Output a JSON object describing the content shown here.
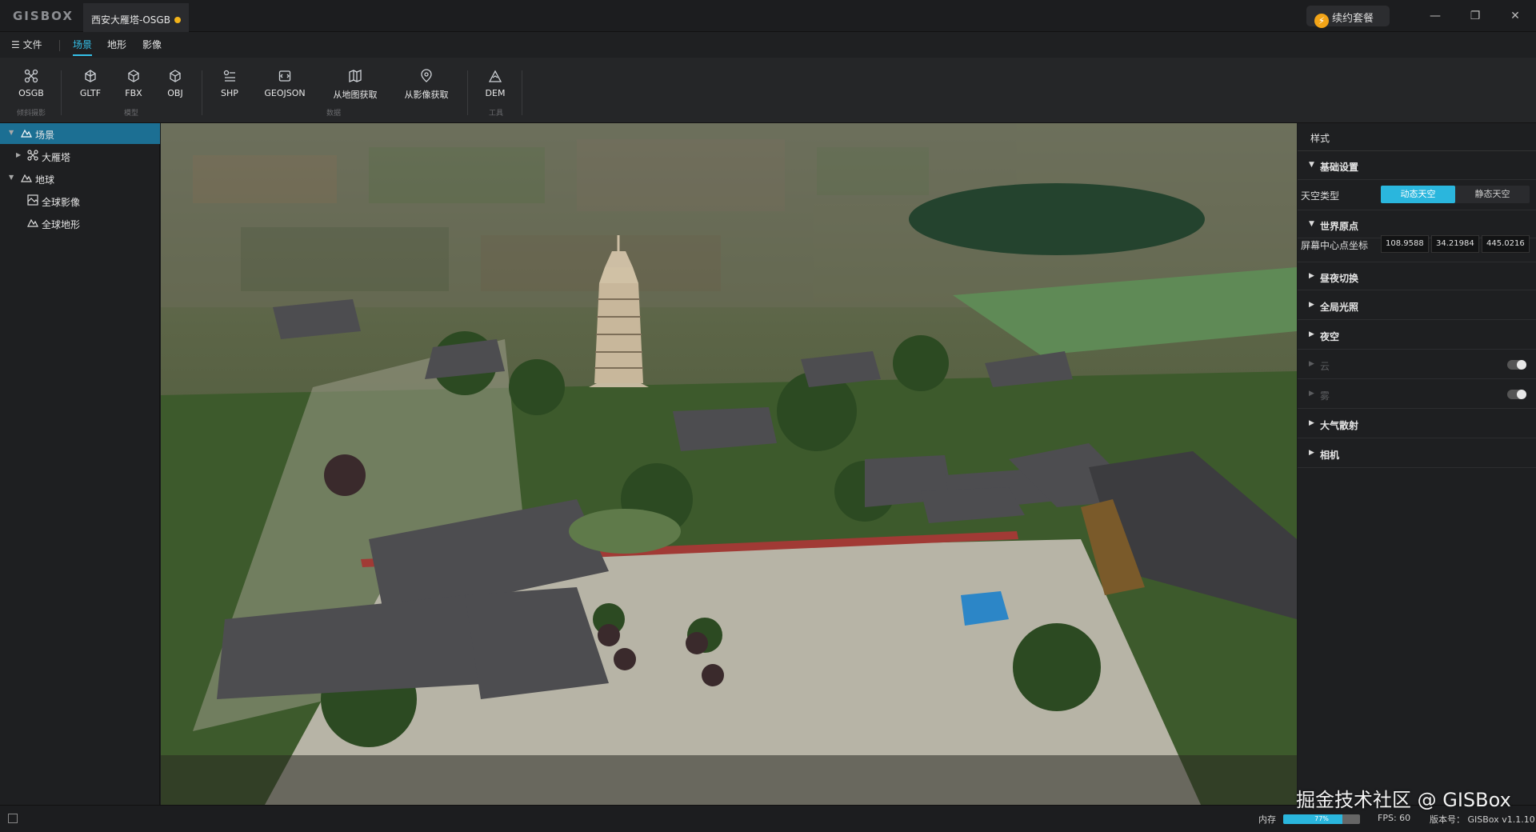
{
  "app": {
    "logo": "GISBOX",
    "document_tab": "西安大雁塔-OSGB",
    "renew_button": "续约套餐",
    "window_controls": [
      "minimize-icon",
      "restore-icon",
      "close-icon"
    ]
  },
  "menubar": {
    "file": "☰ 文件",
    "tabs": [
      {
        "label": "场景",
        "active": true
      },
      {
        "label": "地形",
        "active": false
      },
      {
        "label": "影像",
        "active": false
      }
    ]
  },
  "toolbar": {
    "tools": [
      {
        "label": "OSGB",
        "icon": "osgb-icon"
      },
      {
        "label": "GLTF",
        "icon": "gltf-icon"
      },
      {
        "label": "FBX",
        "icon": "fbx-icon"
      },
      {
        "label": "OBJ",
        "icon": "obj-icon"
      },
      {
        "label": "SHP",
        "icon": "shp-icon"
      },
      {
        "label": "GEOJSON",
        "icon": "geojson-icon"
      },
      {
        "label": "从地图获取",
        "icon": "map-fetch-icon"
      },
      {
        "label": "从影像获取",
        "icon": "imagery-fetch-icon"
      },
      {
        "label": "DEM",
        "icon": "dem-icon"
      }
    ],
    "groups": [
      "倾斜摄影",
      "模型",
      "数据",
      "工具"
    ]
  },
  "tree": {
    "items": [
      {
        "label": "场景",
        "level": 0,
        "expanded": true,
        "selected": true,
        "icon": "scene-icon"
      },
      {
        "label": "大雁塔",
        "level": 1,
        "expanded": false,
        "selected": false,
        "icon": "osgb-layer-icon"
      },
      {
        "label": "地球",
        "level": 0,
        "expanded": true,
        "selected": false,
        "icon": "globe-icon"
      },
      {
        "label": "全球影像",
        "level": 1,
        "expanded": false,
        "selected": false,
        "icon": "imagery-icon"
      },
      {
        "label": "全球地形",
        "level": 1,
        "expanded": false,
        "selected": false,
        "icon": "terrain-icon"
      }
    ]
  },
  "right_panel": {
    "tab": "样式",
    "basic_settings": {
      "title": "基础设置",
      "sky_type_label": "天空类型",
      "sky_options": [
        {
          "label": "动态天空",
          "selected": true
        },
        {
          "label": "静态天空",
          "selected": false
        }
      ]
    },
    "world_origin": {
      "title": "世界原点",
      "center_label": "屏幕中心点坐标",
      "lon": "108.9588",
      "lat": "34.21984",
      "height": "445.0216"
    },
    "sections": [
      {
        "title": "昼夜切换",
        "disabled": false
      },
      {
        "title": "全局光照",
        "disabled": false
      },
      {
        "title": "夜空",
        "disabled": false
      },
      {
        "title": "云",
        "disabled": true,
        "toggle": false
      },
      {
        "title": "雾",
        "disabled": true,
        "toggle": false
      },
      {
        "title": "大气散射",
        "disabled": false
      },
      {
        "title": "相机",
        "disabled": false
      }
    ]
  },
  "statusbar": {
    "memory_label": "内存",
    "memory_percent": 77,
    "memory_text": "77%",
    "fps": "FPS: 60",
    "version": "版本号： GISBox v1.1.10"
  },
  "watermark": "掘金技术社区 @ GISBox",
  "colors": {
    "accent": "#2ab6dd",
    "selected_row": "#1c6f93",
    "unsaved_dot": "#f2b31a"
  }
}
